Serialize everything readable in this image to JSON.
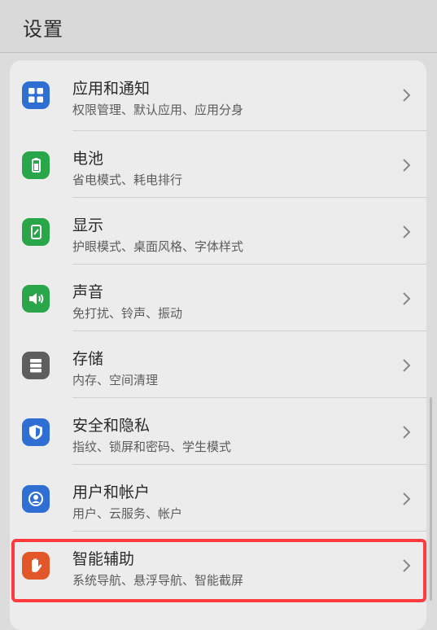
{
  "header": {
    "title": "设置"
  },
  "items": [
    {
      "title": "应用和通知",
      "subtitle": "权限管理、默认应用、应用分身",
      "icon": "apps-grid-icon",
      "color": "#2f6fd3"
    },
    {
      "title": "电池",
      "subtitle": "省电模式、耗电排行",
      "icon": "battery-icon",
      "color": "#29a54a"
    },
    {
      "title": "显示",
      "subtitle": "护眼模式、桌面风格、字体样式",
      "icon": "display-icon",
      "color": "#29a54a"
    },
    {
      "title": "声音",
      "subtitle": "免打扰、铃声、振动",
      "icon": "speaker-icon",
      "color": "#29a54a"
    },
    {
      "title": "存储",
      "subtitle": "内存、空间清理",
      "icon": "storage-icon",
      "color": "#5e5e5e"
    },
    {
      "title": "安全和隐私",
      "subtitle": "指纹、锁屏和密码、学生模式",
      "icon": "shield-icon",
      "color": "#2f6fd3"
    },
    {
      "title": "用户和帐户",
      "subtitle": "用户、云服务、帐户",
      "icon": "user-icon",
      "color": "#2f6fd3"
    },
    {
      "title": "智能辅助",
      "subtitle": "系统导航、悬浮导航、智能截屏",
      "icon": "hand-icon",
      "color": "#e2572a"
    }
  ],
  "highlight": {
    "color": "#ff3b3f"
  }
}
